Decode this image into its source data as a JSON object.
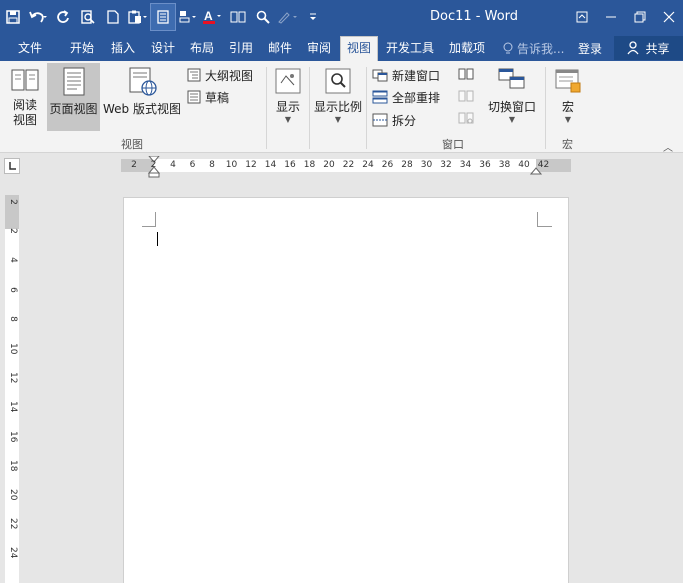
{
  "window": {
    "title": "Doc11 - Word"
  },
  "qat": {
    "icons": [
      "save-icon",
      "undo-icon",
      "redo-icon",
      "print-preview-icon",
      "new-document-icon",
      "paste-icon",
      "page-view-icon",
      "format-painter-icon",
      "font-color-icon",
      "columns-icon",
      "find-icon",
      "draw-icon",
      "customize-icon"
    ],
    "font_color_accent": "#e81123"
  },
  "tabs": [
    {
      "label": "文件"
    },
    {
      "label": "开始"
    },
    {
      "label": "插入"
    },
    {
      "label": "设计"
    },
    {
      "label": "布局"
    },
    {
      "label": "引用"
    },
    {
      "label": "邮件"
    },
    {
      "label": "审阅"
    },
    {
      "label": "视图",
      "active": true
    },
    {
      "label": "开发工具"
    },
    {
      "label": "加载项"
    }
  ],
  "tellme": {
    "placeholder": "告诉我..."
  },
  "account": {
    "login": "登录",
    "share": "共享"
  },
  "ribbon": {
    "views": {
      "read_mode": "阅读\n视图",
      "print_layout": "页面视图",
      "web_layout": "Web 版式视图",
      "outline": "大纲视图",
      "draft": "草稿",
      "group_label": "视图"
    },
    "show": {
      "label": "显示"
    },
    "zoom": {
      "label": "显示比例"
    },
    "window": {
      "new_window": "新建窗口",
      "arrange_all": "全部重排",
      "split": "拆分",
      "switch_windows": "切换窗口",
      "group_label": "窗口"
    },
    "macros": {
      "label": "宏",
      "group_label": "宏"
    }
  },
  "hruler": {
    "ticks": [
      "2",
      "2",
      "4",
      "6",
      "8",
      "10",
      "12",
      "14",
      "16",
      "18",
      "20",
      "22",
      "24",
      "26",
      "28",
      "30",
      "32",
      "34",
      "36",
      "38",
      "40",
      "42"
    ]
  },
  "vruler": {
    "ticks": [
      "2",
      "2",
      "4",
      "6",
      "8",
      "10",
      "12",
      "14",
      "16",
      "18",
      "20",
      "22",
      "24"
    ]
  },
  "colors": {
    "accent": "#2b579a",
    "ribbon_bg": "#f3f3f3",
    "workspace": "#e6e6e6"
  }
}
